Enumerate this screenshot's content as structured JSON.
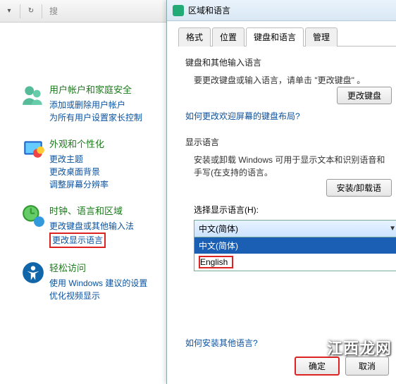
{
  "topbar": {
    "search_placeholder": "搜"
  },
  "left": {
    "cat1": {
      "title": "用户帐户和家庭安全",
      "l1": "添加或删除用户帐户",
      "l2": "为所有用户设置家长控制"
    },
    "cat2": {
      "title": "外观和个性化",
      "l1": "更改主题",
      "l2": "更改桌面背景",
      "l3": "调整屏幕分辨率"
    },
    "cat3": {
      "title": "时钟、语言和区域",
      "l1": "更改键盘或其他输入法",
      "l2": "更改显示语言"
    },
    "cat4": {
      "title": "轻松访问",
      "l1": "使用 Windows 建议的设置",
      "l2": "优化视频显示"
    }
  },
  "dialog": {
    "title": "区域和语言",
    "tabs": {
      "t1": "格式",
      "t2": "位置",
      "t3": "键盘和语言",
      "t4": "管理"
    },
    "kb": {
      "head": "键盘和其他输入语言",
      "desc": "要更改键盘或输入语言，请单击 \"更改键盘\" 。",
      "btn": "更改键盘",
      "link": "如何更改欢迎屏幕的键盘布局?"
    },
    "disp": {
      "head": "显示语言",
      "desc": "安装或卸载 Windows 可用于显示文本和识别语音和手写(在支持的语言。",
      "btn": "安装/卸载语",
      "label": "选择显示语言(H):",
      "opts": {
        "o1": "中文(简体)",
        "o2": "中文(简体)",
        "o3": "English"
      }
    },
    "bottomlink": "如何安装其他语言?",
    "ok": "确定",
    "cancel": "取消"
  },
  "watermark": "江西龙网"
}
